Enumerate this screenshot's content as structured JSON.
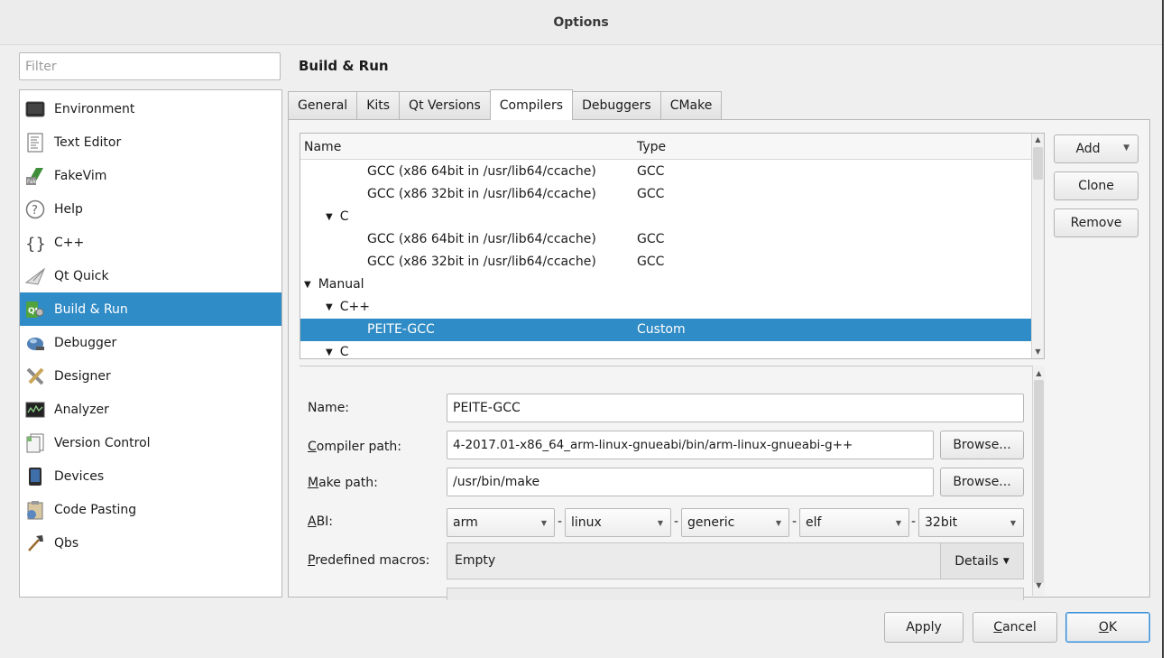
{
  "window": {
    "title": "Options"
  },
  "filter": {
    "placeholder": "Filter"
  },
  "nav": {
    "items": [
      {
        "label": "Environment",
        "icon": "environment-icon"
      },
      {
        "label": "Text Editor",
        "icon": "text-editor-icon"
      },
      {
        "label": "FakeVim",
        "icon": "fakevim-icon"
      },
      {
        "label": "Help",
        "icon": "help-icon"
      },
      {
        "label": "C++",
        "icon": "cpp-braces-icon"
      },
      {
        "label": "Qt Quick",
        "icon": "qt-quick-icon"
      },
      {
        "label": "Build & Run",
        "icon": "build-run-icon",
        "selected": true
      },
      {
        "label": "Debugger",
        "icon": "debugger-icon"
      },
      {
        "label": "Designer",
        "icon": "designer-icon"
      },
      {
        "label": "Analyzer",
        "icon": "analyzer-icon"
      },
      {
        "label": "Version Control",
        "icon": "version-control-icon"
      },
      {
        "label": "Devices",
        "icon": "devices-icon"
      },
      {
        "label": "Code Pasting",
        "icon": "code-pasting-icon"
      },
      {
        "label": "Qbs",
        "icon": "qbs-hammer-icon"
      }
    ],
    "selected_color": "#308cc6"
  },
  "page": {
    "title": "Build & Run"
  },
  "tabs": [
    {
      "label": "General"
    },
    {
      "label": "Kits"
    },
    {
      "label": "Qt Versions"
    },
    {
      "label": "Compilers",
      "active": true
    },
    {
      "label": "Debuggers"
    },
    {
      "label": "CMake"
    }
  ],
  "compilers": {
    "columns": {
      "name": "Name",
      "type": "Type"
    },
    "rows": [
      {
        "name": "GCC (x86 64bit in /usr/lib64/ccache)",
        "type": "GCC",
        "level": 2
      },
      {
        "name": "GCC (x86 32bit in /usr/lib64/ccache)",
        "type": "GCC",
        "level": 2
      },
      {
        "name": "C",
        "type": "",
        "level": 1,
        "expanded": true
      },
      {
        "name": "GCC (x86 64bit in /usr/lib64/ccache)",
        "type": "GCC",
        "level": 2
      },
      {
        "name": "GCC (x86 32bit in /usr/lib64/ccache)",
        "type": "GCC",
        "level": 2
      },
      {
        "name": "Manual",
        "type": "",
        "level": 0,
        "expanded": true
      },
      {
        "name": "C++",
        "type": "",
        "level": 1,
        "expanded": true
      },
      {
        "name": "PEITE-GCC",
        "type": "Custom",
        "level": 2,
        "selected": true
      },
      {
        "name": "C",
        "type": "",
        "level": 1,
        "expanded": true
      }
    ],
    "buttons": {
      "add": "Add",
      "clone": "Clone",
      "remove": "Remove"
    }
  },
  "details": {
    "name": {
      "label": "Name:",
      "value": "PEITE-GCC"
    },
    "compiler_path": {
      "label_access": "C",
      "label_rest": "ompiler path:",
      "value": "4-2017.01-x86_64_arm-linux-gnueabi/bin/arm-linux-gnueabi-g++",
      "browse": "Browse..."
    },
    "make_path": {
      "label_access": "M",
      "label_rest": "ake path:",
      "value": "/usr/bin/make",
      "browse": "Browse..."
    },
    "abi": {
      "label_access": "A",
      "label_rest": "BI:",
      "architecture": "arm",
      "os": "linux",
      "flavor": "generic",
      "format": "elf",
      "width": "32bit",
      "separator": "-"
    },
    "macros": {
      "label_access": "P",
      "label_rest": "redefined macros:",
      "value": "Empty",
      "details": "Details"
    }
  },
  "footer": {
    "apply": "Apply",
    "cancel_access": "C",
    "cancel_rest": "ancel",
    "ok_access": "O",
    "ok_rest": "K"
  }
}
